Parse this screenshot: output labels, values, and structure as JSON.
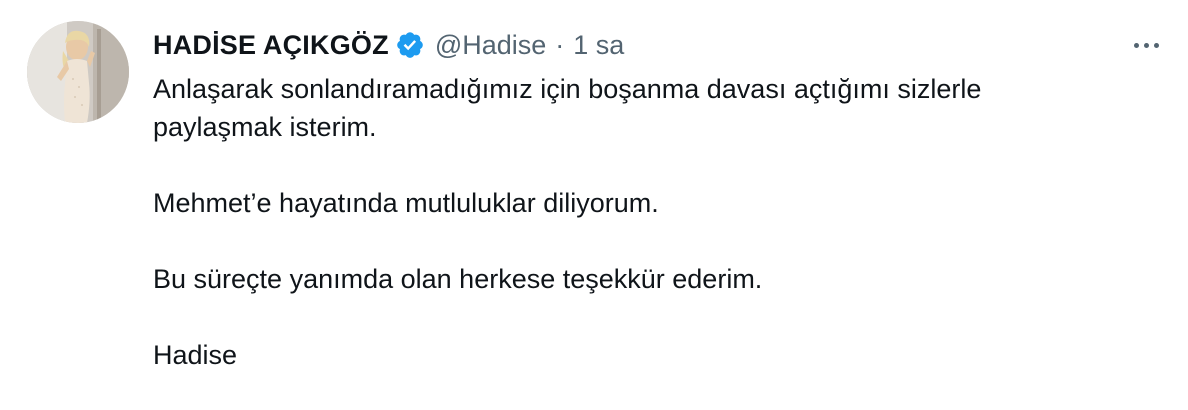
{
  "tweet": {
    "display_name": "HADİSE AÇIKGÖZ",
    "handle": "@Hadise",
    "separator": "·",
    "time": "1 sa",
    "verified_icon": "verified-badge-icon",
    "avatar_icon": "profile-avatar",
    "more_icon": "more-options-icon",
    "paragraphs": {
      "p1_line1": "Anlaşarak sonlandıramadığımız için boşanma davası açtığımı sizlerle",
      "p1_line2": "paylaşmak isterim.",
      "p2": "Mehmet’e hayatında mutluluklar diliyorum.",
      "p3": "Bu süreçte yanımda olan herkese teşekkür ederim.",
      "p4": "Hadise"
    }
  },
  "colors": {
    "text_primary": "#0f1419",
    "text_secondary": "#536471",
    "verified_blue": "#1d9bf0"
  }
}
